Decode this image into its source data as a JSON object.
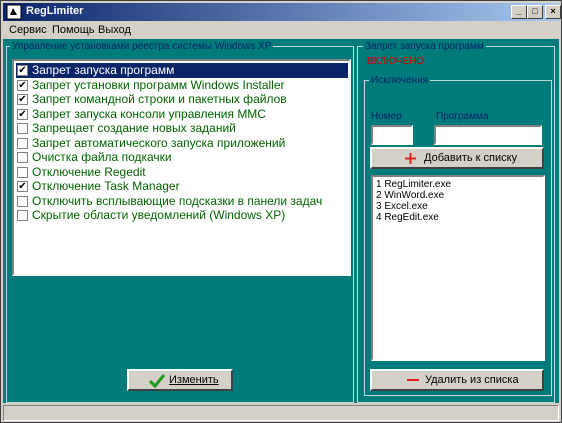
{
  "window": {
    "title": "RegLimiter"
  },
  "title_buttons": {
    "minimize": "_",
    "maximize": "□",
    "close": "×"
  },
  "menu": [
    "Сервис",
    "Помощь",
    "Выход"
  ],
  "left_group": {
    "title": "Управление установками реестра системы Windows XP",
    "options": [
      {
        "label": "Запрет запуска программ",
        "checked": true,
        "selected": true
      },
      {
        "label": "Запрет установки программ Windows Installer",
        "checked": true,
        "selected": false
      },
      {
        "label": "Запрет командной строки и пакетных файлов",
        "checked": true,
        "selected": false
      },
      {
        "label": "Запрет запуска консоли управления MMC",
        "checked": true,
        "selected": false
      },
      {
        "label": "Запрещает создание новых заданий",
        "checked": false,
        "selected": false
      },
      {
        "label": "Запрет автоматического запуска приложений",
        "checked": false,
        "selected": false
      },
      {
        "label": "Очистка файла подкачки",
        "checked": false,
        "selected": false
      },
      {
        "label": "Отключение Regedit",
        "checked": false,
        "selected": false
      },
      {
        "label": "Отключение  Task Manager",
        "checked": true,
        "selected": false
      },
      {
        "label": "Отключить всплывающие подсказки в панели задач",
        "checked": false,
        "selected": false
      },
      {
        "label": "Скрытие области уведомлений (Windows XP)",
        "checked": false,
        "selected": false
      }
    ],
    "apply_button": "Изменить"
  },
  "right_group": {
    "title": "Запрет запуска программ",
    "status": "ВКЛЮЧЕНО",
    "exceptions": {
      "title": "Исключения",
      "number_label": "Номер",
      "program_label": "Программа",
      "number_value": "",
      "program_value": "",
      "add_button": "Добавить к списку",
      "items": [
        "1 RegLimiter.exe",
        "2 WinWord.exe",
        "3 Excel.exe",
        "4 RegEdit.exe"
      ],
      "remove_button": "Удалить из списка"
    }
  },
  "colors": {
    "client_bg": "#007b7b",
    "status_red": "#d00000",
    "check_text": "#006400",
    "add_icon": "#e02020",
    "remove_icon": "#e02020",
    "apply_icon": "#1a9a1a"
  }
}
